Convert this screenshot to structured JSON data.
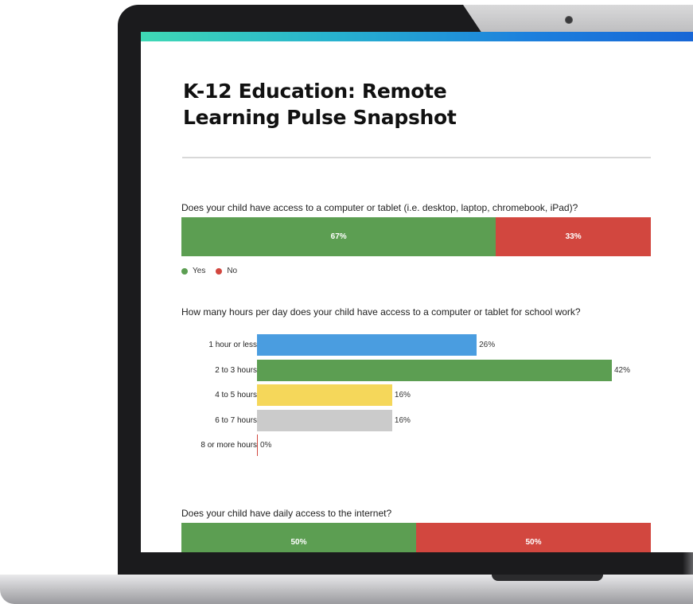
{
  "page_title": "K-12 Education: Remote Learning Pulse Snapshot",
  "colors": {
    "yes": "#5c9e52",
    "no": "#d2473f",
    "accent_start": "#3fd9b5",
    "accent_end": "#1766d6"
  },
  "q1": {
    "question": "Does your child have access to a computer or tablet (i.e. desktop, laptop, chromebook, iPad)?",
    "segments": [
      {
        "label": "Yes",
        "value": 67,
        "display": "67%",
        "color": "#5c9e52"
      },
      {
        "label": "No",
        "value": 33,
        "display": "33%",
        "color": "#d2473f"
      }
    ],
    "legend": [
      {
        "label": "Yes",
        "color": "#5c9e52"
      },
      {
        "label": "No",
        "color": "#d2473f"
      }
    ]
  },
  "q2": {
    "question": "How many hours per day does your child have access to a computer or tablet for school work?"
  },
  "chart_data": {
    "type": "bar",
    "orientation": "horizontal",
    "categories": [
      "1 hour or less",
      "2 to 3 hours",
      "4 to 5 hours",
      "6 to 7 hours",
      "8 or more hours"
    ],
    "values": [
      26,
      42,
      16,
      16,
      0
    ],
    "value_labels": [
      "26%",
      "42%",
      "16%",
      "16%",
      "0%"
    ],
    "colors": [
      "#4a9de0",
      "#5c9e52",
      "#f5d75a",
      "#cbcbcb",
      "#d2473f"
    ],
    "xlim": [
      0,
      42
    ],
    "grid": false
  },
  "q3": {
    "question": "Does your child have daily access to the internet?",
    "segments": [
      {
        "label": "Yes",
        "value": 50,
        "display": "50%",
        "color": "#5c9e52"
      },
      {
        "label": "No",
        "value": 50,
        "display": "50%",
        "color": "#d2473f"
      }
    ]
  }
}
